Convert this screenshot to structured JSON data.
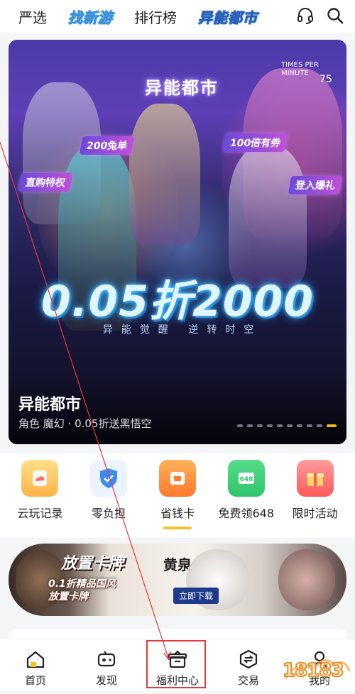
{
  "topnav": {
    "tabs": [
      {
        "label": "严选",
        "style": "plain"
      },
      {
        "label": "找新游",
        "style": "stylized"
      },
      {
        "label": "排行榜",
        "style": "plain"
      },
      {
        "label": "异能都市",
        "style": "stylized"
      }
    ],
    "icons": [
      "headset-icon",
      "search-icon"
    ]
  },
  "banner": {
    "game_logo_text": "异能都市",
    "tags": [
      "200兔单",
      "100倍有券",
      "直购特权",
      "登入爆礼"
    ],
    "promo_main": "0.05折2000",
    "promo_sub": "异能觉醒  逆转时空",
    "game_name": "异能都市",
    "game_desc": "角色 魔幻 · 0.05折送黑悟空",
    "dots_total": 10,
    "dots_active_index": 9,
    "small_text_tr": "TIMES PER MINUTE",
    "small_number_tr": "75"
  },
  "quick": [
    {
      "label": "云玩记录",
      "icon": "cloud-play-icon",
      "color": "#ff8a5c"
    },
    {
      "label": "零负担",
      "icon": "shield-icon",
      "color": "#3d8cf0"
    },
    {
      "label": "省钱卡",
      "icon": "savings-card-icon",
      "color": "#ff7a2e",
      "active": true
    },
    {
      "label": "免费领648",
      "icon": "gift-648-icon",
      "color": "#2fc46b"
    },
    {
      "label": "限时活动",
      "icon": "gift-box-icon",
      "color": "#ff5a5a"
    }
  ],
  "ad": {
    "logo": "放置卡牌",
    "headline_1": "0.1折精品国风",
    "headline_2": "放置卡牌",
    "button": "立即下载",
    "calligraphy": "黄泉"
  },
  "bottomnav": {
    "items": [
      {
        "label": "首页",
        "icon": "home-icon"
      },
      {
        "label": "发现",
        "icon": "gamepad-icon"
      },
      {
        "label": "福利中心",
        "icon": "gift-icon"
      },
      {
        "label": "交易",
        "icon": "trade-icon"
      },
      {
        "label": "我的",
        "icon": "profile-icon"
      }
    ]
  },
  "watermark": "18183",
  "colors": {
    "accent_yellow": "#f5c02a",
    "annotation_red": "#e03a3a",
    "stylized_blue": "#3a8fd6"
  }
}
